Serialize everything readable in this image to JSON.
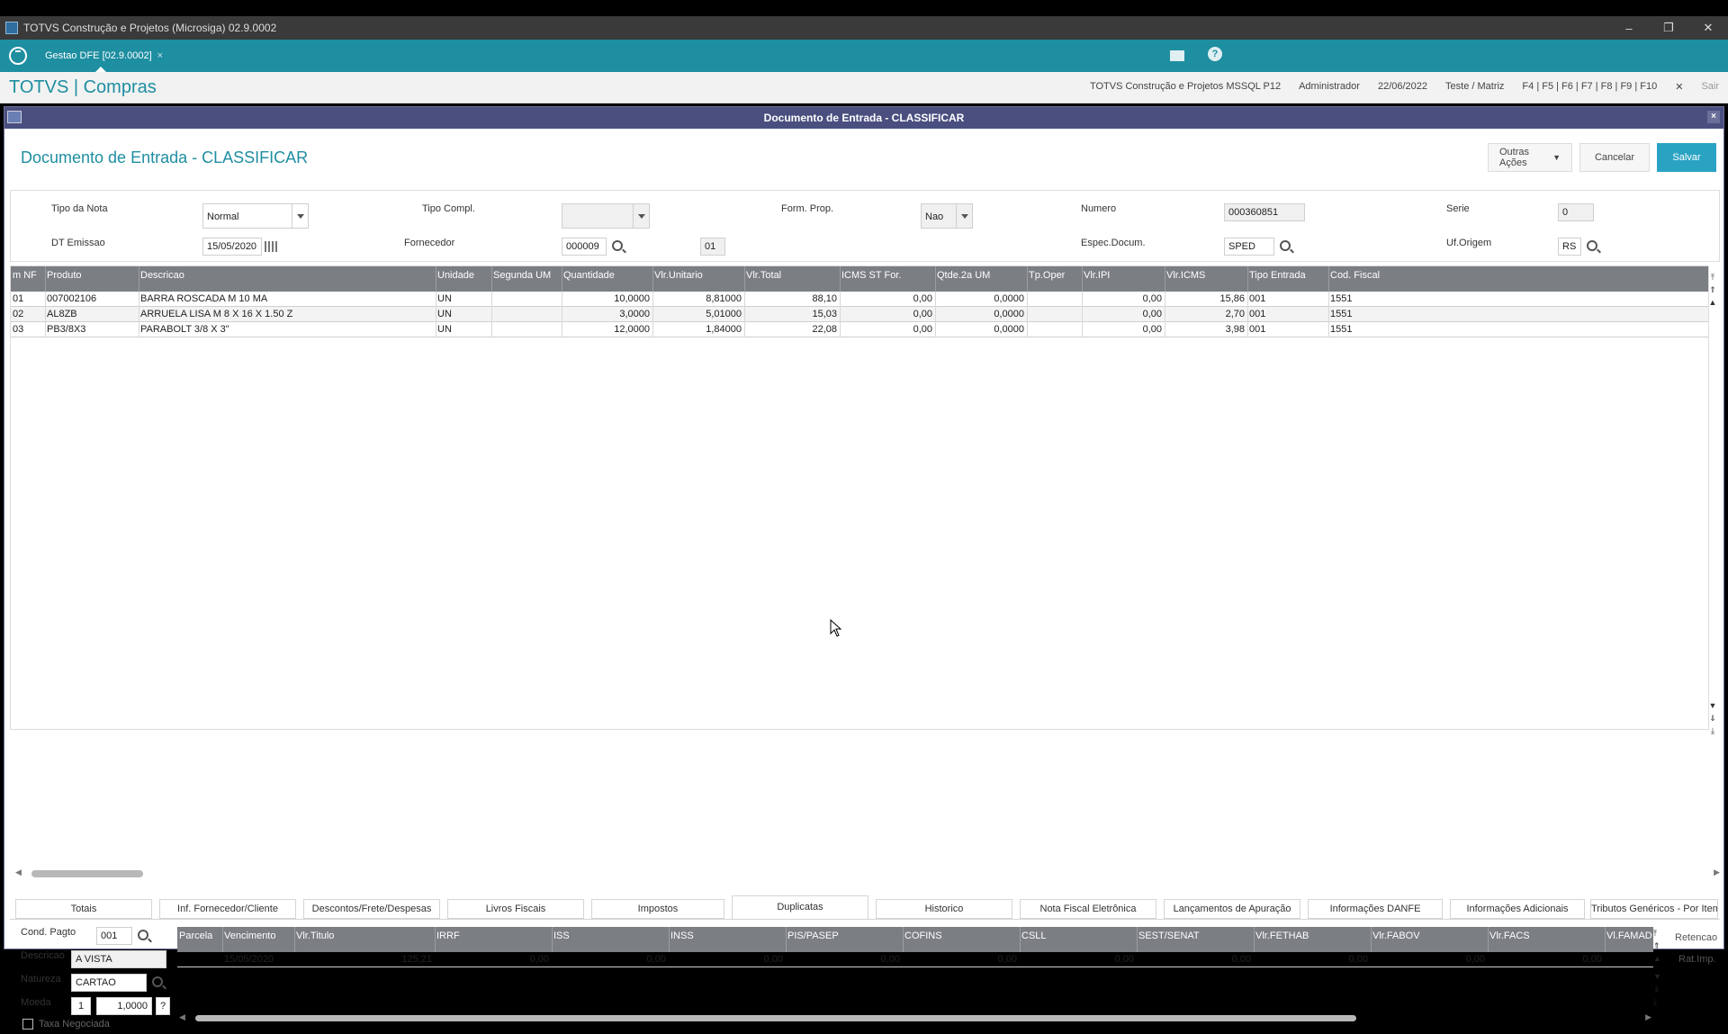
{
  "window": {
    "title": "TOTVS Construção e Projetos (Microsiga) 02.9.0002",
    "minimize": "–",
    "restore": "❐",
    "close": "✕"
  },
  "tabstrip": {
    "tab_label": "Gestao DFE [02.9.0002]",
    "tab_close": "×"
  },
  "app": {
    "brand": "TOTVS | Compras",
    "company": "TOTVS Construção e Projetos MSSQL P12",
    "user": "Administrador",
    "date": "22/06/2022",
    "branch": "Teste / Matriz",
    "fkeys": "F4 | F5 | F6 | F7 | F8 | F9 | F10",
    "exit": "Sair",
    "exit_icon": "✕"
  },
  "dialog": {
    "title": "Documento de Entrada - CLASSIFICAR",
    "page_title": "Documento de Entrada - CLASSIFICAR",
    "close": "×",
    "actions": {
      "outras": "Outras Ações",
      "cancelar": "Cancelar",
      "salvar": "Salvar"
    }
  },
  "header_form": {
    "tipo_nota": {
      "label": "Tipo da Nota",
      "value": "Normal"
    },
    "tipo_compl": {
      "label": "Tipo Compl.",
      "value": ""
    },
    "form_prop": {
      "label": "Form. Prop.",
      "value": "Nao"
    },
    "numero": {
      "label": "Numero",
      "value": "000360851"
    },
    "serie": {
      "label": "Serie",
      "value": "0"
    },
    "dt_emissao": {
      "label": "DT Emissao",
      "value": "15/05/2020"
    },
    "fornecedor": {
      "label": "Fornecedor",
      "value": "000009",
      "loja": "01"
    },
    "espec_docum": {
      "label": "Espec.Docum.",
      "value": "SPED"
    },
    "uf_origem": {
      "label": "Uf.Origem",
      "value": "RS"
    }
  },
  "items_grid": {
    "columns": [
      "m NF",
      "Produto",
      "Descricao",
      "Unidade",
      "Segunda UM",
      "Quantidade",
      "Vlr.Unitario",
      "Vlr.Total",
      "ICMS ST For.",
      "Qtde.2a UM",
      "Tp.Oper",
      "Vlr.IPI",
      "Vlr.ICMS",
      "Tipo Entrada",
      "Cod. Fiscal"
    ],
    "rows": [
      [
        "01",
        "007002106",
        "BARRA ROSCADA M 10 MA",
        "UN",
        "",
        "10,0000",
        "8,81000",
        "88,10",
        "0,00",
        "0,0000",
        "",
        "0,00",
        "15,86",
        "001",
        "1551"
      ],
      [
        "02",
        "AL8ZB",
        "ARRUELA LISA M 8 X 16 X 1.50 Z",
        "UN",
        "",
        "3,0000",
        "5,01000",
        "15,03",
        "0,00",
        "0,0000",
        "",
        "0,00",
        "2,70",
        "001",
        "1551"
      ],
      [
        "03",
        "PB3/8X3",
        "PARABOLT 3/8 X 3\"",
        "UN",
        "",
        "12,0000",
        "1,84000",
        "22,08",
        "0,00",
        "0,0000",
        "",
        "0,00",
        "3,98",
        "001",
        "1551"
      ]
    ]
  },
  "bottom_tabs": [
    "Totais",
    "Inf. Fornecedor/Cliente",
    "Descontos/Frete/Despesas",
    "Livros Fiscais",
    "Impostos",
    "Duplicatas",
    "Historico",
    "Nota Fiscal Eletrônica",
    "Lançamentos de Apuração",
    "Informações DANFE",
    "Informações Adicionais",
    "Tributos Genéricos - Por Item"
  ],
  "duplicatas": {
    "cond_pagto": {
      "label": "Cond. Pagto",
      "value": "001"
    },
    "descricao": {
      "label": "Descricao",
      "value": "A VISTA"
    },
    "natureza": {
      "label": "Natureza",
      "value": "CARTAO"
    },
    "moeda": {
      "label": "Moeda",
      "value": "1",
      "taxa": "1,0000",
      "help": "?"
    },
    "taxa_negociada": "Taxa Negociada",
    "columns": [
      "Parcela",
      "Vencimento",
      "Vlr.Titulo",
      "IRRF",
      "ISS",
      "INSS",
      "PIS/PASEP",
      "COFINS",
      "CSLL",
      "SEST/SENAT",
      "Vlr.FETHAB",
      "Vlr.FABOV",
      "Vlr.FACS",
      "Vl.FAMAD"
    ],
    "row": [
      "",
      "15/05/2020",
      "125,21",
      "0,00",
      "0,00",
      "0,00",
      "0,00",
      "0,00",
      "0,00",
      "0,00",
      "0,00",
      "0,00",
      "0,00",
      ""
    ],
    "side_buttons": {
      "retencao": "Retencao",
      "rat_imp": "Rat.Imp."
    }
  }
}
